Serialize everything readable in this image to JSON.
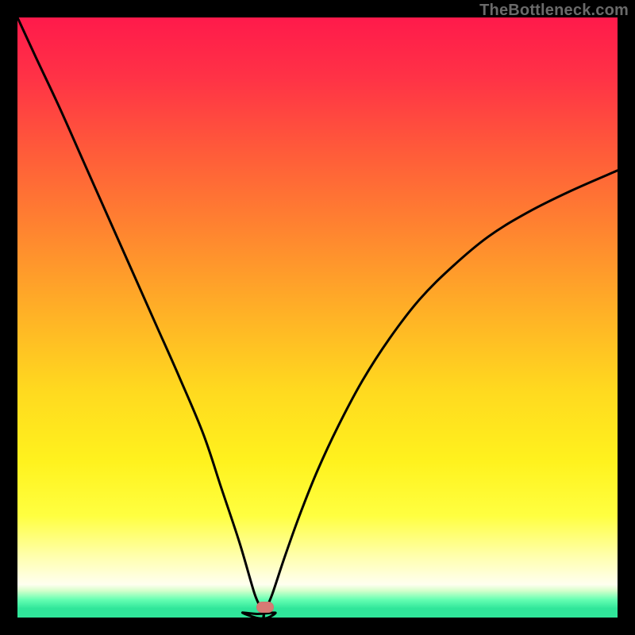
{
  "watermark": "TheBottleneck.com",
  "marker": {
    "x_frac": 0.413,
    "y_frac": 0.983
  },
  "gradient_stops": [
    {
      "offset": 0.0,
      "color": "#ff1a4b"
    },
    {
      "offset": 0.1,
      "color": "#ff3246"
    },
    {
      "offset": 0.22,
      "color": "#ff5a3a"
    },
    {
      "offset": 0.35,
      "color": "#ff8330"
    },
    {
      "offset": 0.48,
      "color": "#ffad27"
    },
    {
      "offset": 0.62,
      "color": "#ffd91f"
    },
    {
      "offset": 0.74,
      "color": "#fff21e"
    },
    {
      "offset": 0.83,
      "color": "#ffff40"
    },
    {
      "offset": 0.9,
      "color": "#ffffb0"
    },
    {
      "offset": 0.945,
      "color": "#fffff0"
    },
    {
      "offset": 0.955,
      "color": "#d6ffcc"
    },
    {
      "offset": 0.97,
      "color": "#66ffb3"
    },
    {
      "offset": 0.985,
      "color": "#30e69a"
    },
    {
      "offset": 1.0,
      "color": "#30e69a"
    }
  ],
  "chart_data": {
    "type": "line",
    "title": "",
    "xlabel": "",
    "ylabel": "",
    "xlim": [
      0,
      1
    ],
    "ylim": [
      0,
      1
    ],
    "x_minimum": 0.41,
    "series": [
      {
        "name": "curve-left",
        "x": [
          0.0,
          0.03,
          0.07,
          0.11,
          0.15,
          0.19,
          0.23,
          0.27,
          0.31,
          0.34,
          0.37,
          0.395,
          0.41
        ],
        "y": [
          1.0,
          0.935,
          0.85,
          0.76,
          0.67,
          0.58,
          0.49,
          0.4,
          0.305,
          0.215,
          0.125,
          0.04,
          0.0
        ]
      },
      {
        "name": "curve-right",
        "x": [
          0.41,
          0.425,
          0.445,
          0.47,
          0.5,
          0.535,
          0.575,
          0.62,
          0.67,
          0.725,
          0.785,
          0.85,
          0.92,
          1.0
        ],
        "y": [
          0.0,
          0.04,
          0.1,
          0.17,
          0.245,
          0.32,
          0.395,
          0.465,
          0.53,
          0.585,
          0.635,
          0.675,
          0.71,
          0.745
        ]
      },
      {
        "name": "floor",
        "x": [
          0.375,
          0.4,
          0.43
        ],
        "y": [
          0.008,
          0.006,
          0.008
        ]
      }
    ]
  }
}
